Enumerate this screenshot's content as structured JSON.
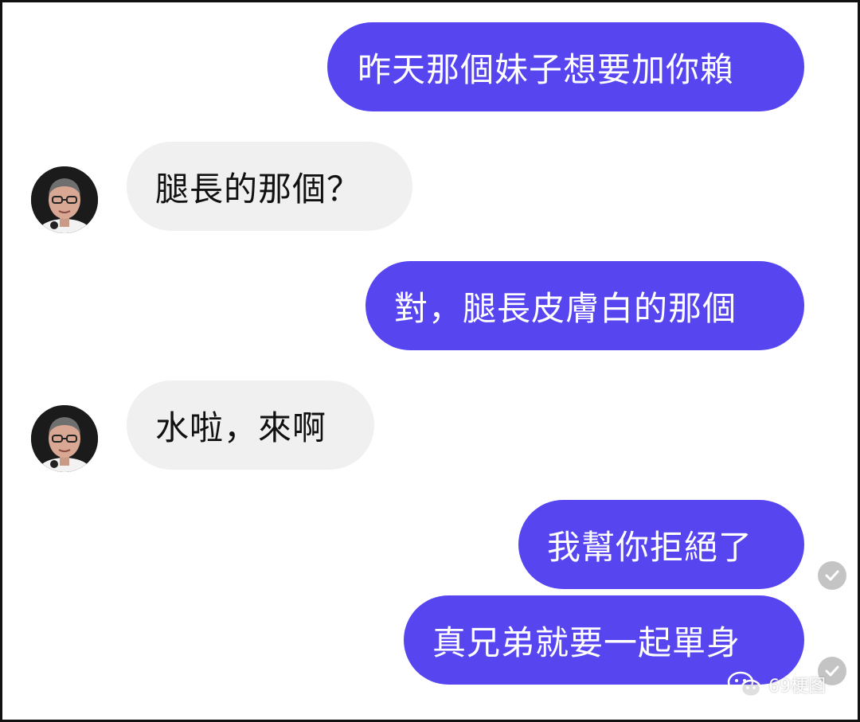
{
  "colors": {
    "sent_bubble": "#5746f0",
    "received_bubble": "#f0f0f0",
    "read_check": "#c4c4c4"
  },
  "conversation": {
    "messages": [
      {
        "direction": "sent",
        "text": "昨天那個妹子想要加你賴"
      },
      {
        "direction": "received",
        "text": "腿長的那個？",
        "avatar": "contact-avatar"
      },
      {
        "direction": "sent",
        "text": "對，腿長皮膚白的那個"
      },
      {
        "direction": "received",
        "text": "水啦，來啊",
        "avatar": "contact-avatar"
      },
      {
        "direction": "sent",
        "text": "我幫你拒絕了",
        "status_icon": "check-icon"
      },
      {
        "direction": "sent",
        "text": "真兄弟就要一起單身",
        "status_icon": "check-icon"
      }
    ]
  },
  "watermark": {
    "icon": "wechat-icon",
    "text": "69梗图"
  }
}
